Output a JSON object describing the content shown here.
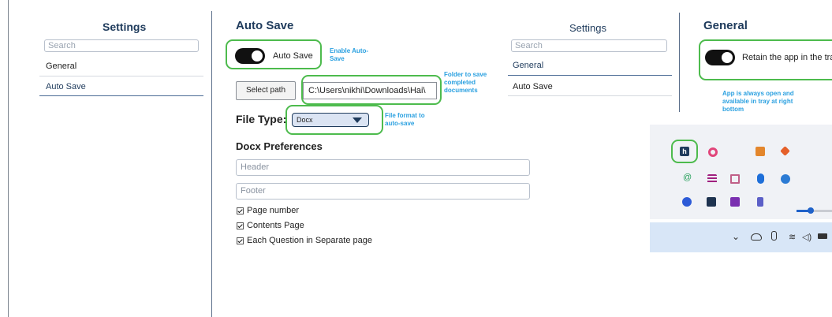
{
  "left_panel": {
    "title": "Settings",
    "search_placeholder": "Search",
    "nav_items": [
      "General",
      "Auto Save"
    ],
    "active_item": "Auto Save"
  },
  "auto_save": {
    "heading": "Auto Save",
    "toggle_label": "Auto Save",
    "toggle_on": true,
    "toggle_note": "Enable Auto-Save",
    "select_path_label": "Select path",
    "path_value": "C:\\Users\\nikhi\\Downloads\\Hai\\",
    "path_note": "Folder to save completed documents",
    "file_type_label": "File Type:",
    "file_type_value": "Docx",
    "file_type_note": "File format to auto-save",
    "docx_heading": "Docx Preferences",
    "header_placeholder": "Header",
    "footer_placeholder": "Footer",
    "checkboxes": [
      {
        "label": "Page number",
        "checked": true
      },
      {
        "label": "Contents Page",
        "checked": true
      },
      {
        "label": "Each Question in Separate page",
        "checked": true
      }
    ]
  },
  "right_panel": {
    "title": "Settings",
    "search_placeholder": "Search",
    "nav_items": [
      "General",
      "Auto Save"
    ],
    "active_item": "General"
  },
  "general": {
    "heading": "General",
    "toggle_label": "Retain the app in the tray",
    "toggle_on": true,
    "toggle_note": "App is always open and available in tray at right bottom"
  },
  "tray_popup": {
    "icons": [
      "h-app-icon",
      "pink-circle-icon",
      "orange-box-icon",
      "orange-diamond-icon",
      "at-sign-icon",
      "stack-icon",
      "shield-icon",
      "bluetooth-icon",
      "vpn-icon",
      "zoom-icon",
      "terminal-icon",
      "onenote-icon",
      "teams-icon"
    ],
    "taskbar_icons": [
      "chevron-up-icon",
      "cloud-icon",
      "microphone-icon",
      "wifi-icon",
      "speaker-icon",
      "battery-icon"
    ]
  },
  "colors": {
    "heading_navy": "#1f3b5c",
    "highlight_green": "#4dbb4d",
    "note_blue": "#2aa0e0",
    "taskbar": "#d8e6f7"
  }
}
